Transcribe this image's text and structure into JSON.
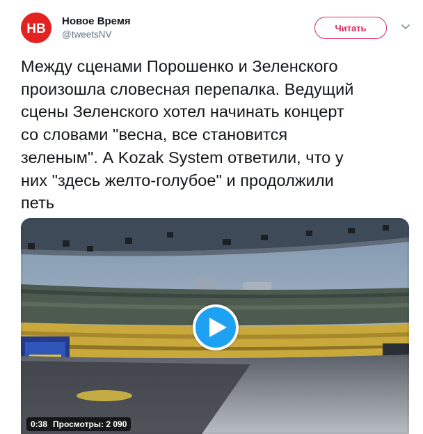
{
  "account": {
    "display_name": "Новое Время",
    "handle": "@tweetsNV",
    "avatar_text": "НВ",
    "brand_color": "#e32322"
  },
  "actions": {
    "follow_label": "Читать",
    "follow_color": "#e0245e",
    "more_icon": "chevron-down-icon"
  },
  "tweet": {
    "text": "Между сценами Порошенко и Зеленского\nпроизошла словесная перепалка. Ведущий\nсцены Зеленского хотел начинать концерт\nсо словами \"весна, все становится\nзеленым\". А Kozak System ответили, что у\nних \"здесь желто-голубое\" и продолжили\nпеть"
  },
  "video": {
    "duration": "0:38",
    "views": "Просмотры: 2 090",
    "play_color": "#1da1f2",
    "play_icon": "play-icon",
    "scene_description_icon": "stadium-thumbnail"
  }
}
